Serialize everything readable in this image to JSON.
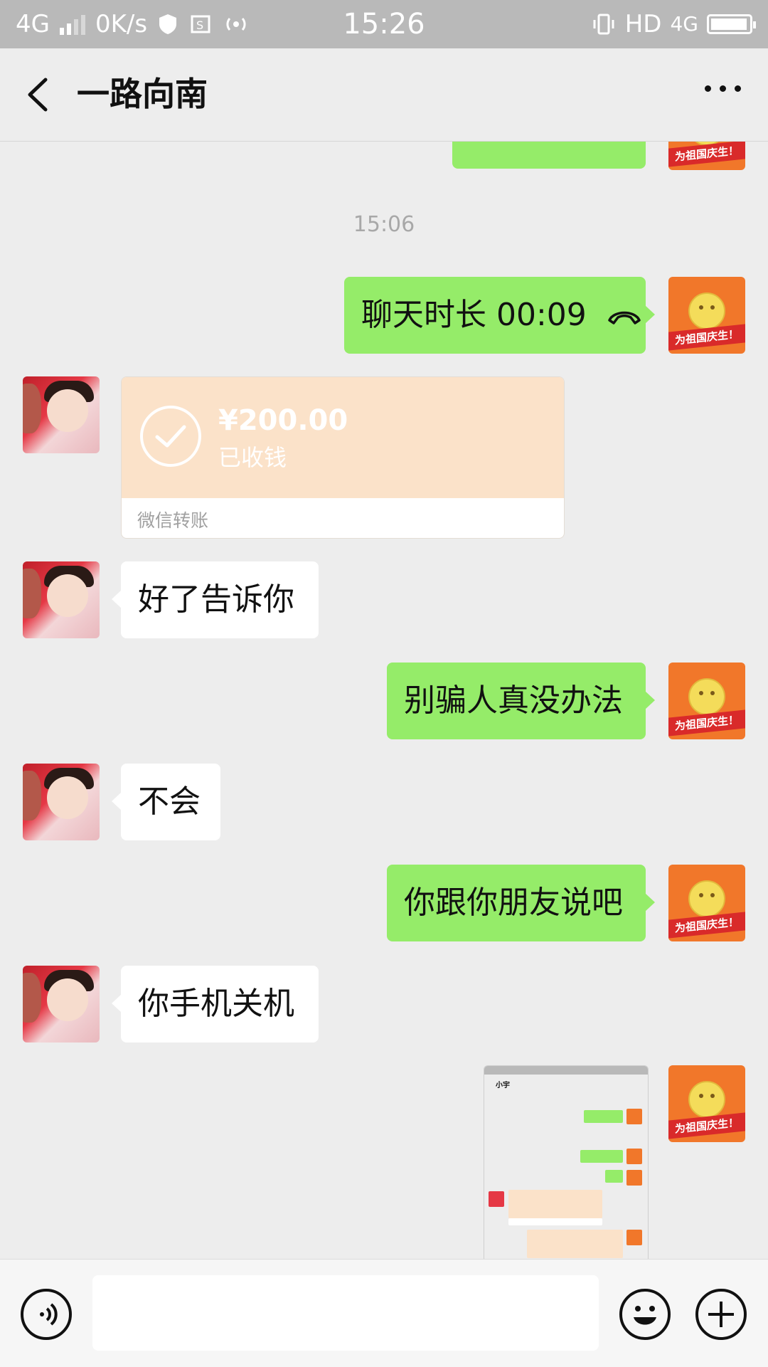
{
  "status_bar": {
    "network_left": "4G",
    "speed": "0K/s",
    "time": "15:26",
    "hd": "HD",
    "network_right": "4G"
  },
  "header": {
    "title": "一路向南"
  },
  "chat": {
    "timestamp": "15:06",
    "call_bubble": {
      "text": "聊天时长 00:09"
    },
    "transfer": {
      "amount": "¥200.00",
      "status": "已收钱",
      "footer": "微信转账"
    },
    "messages": [
      {
        "side": "left",
        "text": "好了告诉你"
      },
      {
        "side": "right",
        "text": "别骗人真没办法"
      },
      {
        "side": "left",
        "text": "不会"
      },
      {
        "side": "right",
        "text": "你跟你朋友说吧"
      },
      {
        "side": "left",
        "text": "你手机关机"
      }
    ],
    "self_avatar_label": "为祖国庆生！",
    "screenshot_thumb": {
      "title": "小宇"
    }
  },
  "input_bar": {
    "icons": [
      "voice-icon",
      "emoji-icon",
      "plus-icon"
    ]
  },
  "colors": {
    "accent_green": "#95ec69",
    "transfer_orange": "#fbe2c9",
    "background": "#ededed"
  }
}
